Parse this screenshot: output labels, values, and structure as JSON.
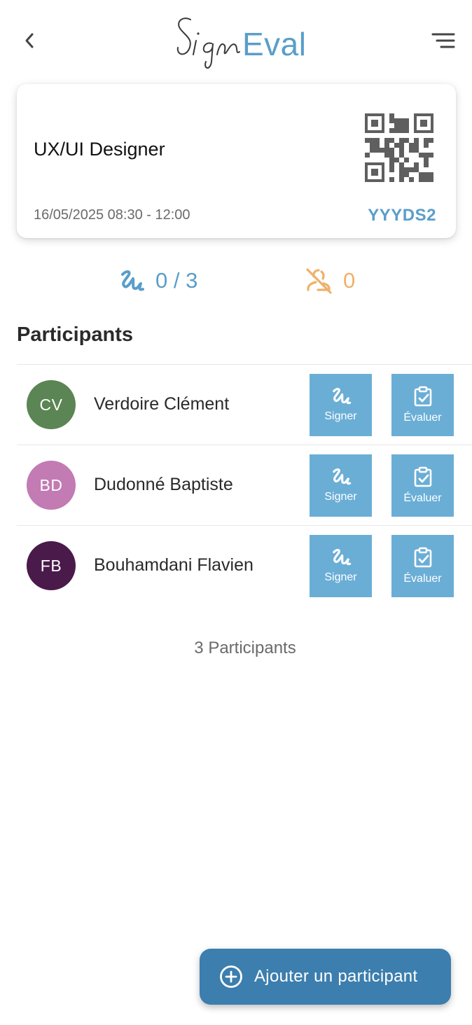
{
  "header": {
    "back_icon": "chevron-left-icon",
    "menu_icon": "menu-icon",
    "logo": {
      "sign_text": "Sign",
      "eval_text": "Eval"
    }
  },
  "session": {
    "title": "UX/UI Designer",
    "datetime": "16/05/2025 08:30 - 12:00",
    "code": "YYYDS2",
    "qr_icon": "qr-code-icon"
  },
  "stats": {
    "signatures": "0 / 3",
    "absences": "0",
    "signature_icon": "signature-icon",
    "absence_icon": "absent-user-icon"
  },
  "participants": {
    "title": "Participants",
    "items": [
      {
        "initials": "CV",
        "name": "Verdoire Clément",
        "color": "#5b8554"
      },
      {
        "initials": "BD",
        "name": "Dudonné Baptiste",
        "color": "#c27bb3"
      },
      {
        "initials": "FB",
        "name": "Bouhamdani Flavien",
        "color": "#4a1a4a"
      }
    ],
    "sign_label": "Signer",
    "eval_label": "Évaluer",
    "count": "3 Participants"
  },
  "fab": {
    "label": "Ajouter un participant",
    "icon": "add-circle-icon"
  },
  "colors": {
    "accent": "#5a9ec9",
    "button": "#6aaed6",
    "fab": "#3c7eae",
    "warning": "#f0b06a"
  }
}
